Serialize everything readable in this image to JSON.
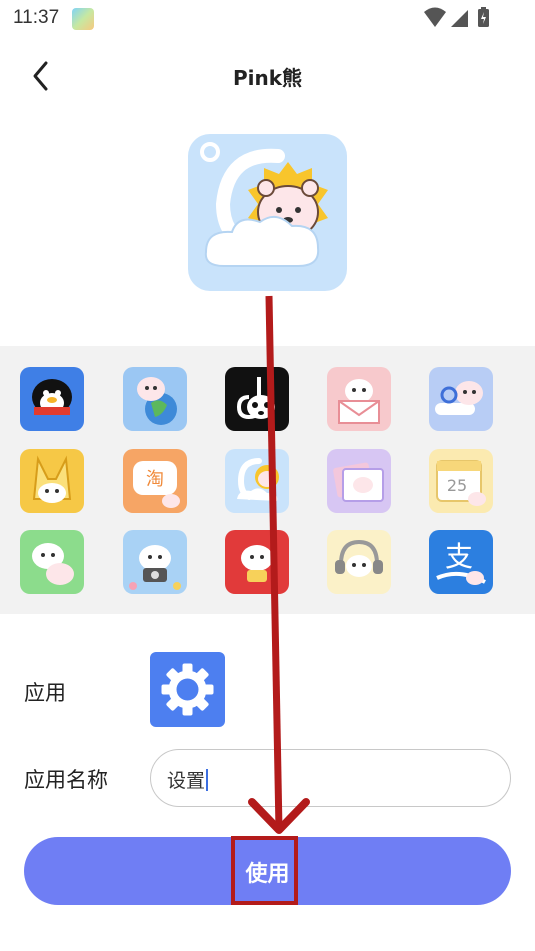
{
  "status_bar": {
    "time": "11:37"
  },
  "header": {
    "title": "Pink熊"
  },
  "icons": [
    {
      "name": "qq-penguin-icon"
    },
    {
      "name": "browser-globe-icon"
    },
    {
      "name": "tiktok-bear-icon"
    },
    {
      "name": "mail-bear-icon"
    },
    {
      "name": "search-bear-icon"
    },
    {
      "name": "yellow-character-icon"
    },
    {
      "name": "taobao-bear-icon"
    },
    {
      "name": "weather-sun-bear-icon"
    },
    {
      "name": "gallery-bear-icon"
    },
    {
      "name": "calendar-bear-icon"
    },
    {
      "name": "wechat-bear-icon"
    },
    {
      "name": "camera-bear-icon"
    },
    {
      "name": "red-app-bear-icon"
    },
    {
      "name": "music-bear-icon"
    },
    {
      "name": "alipay-bear-icon"
    }
  ],
  "form": {
    "app_label": "应用",
    "name_label": "应用名称",
    "name_value": "设置"
  },
  "use_button": {
    "label": "使用"
  },
  "annotation": {
    "color": "#b31b1b"
  }
}
